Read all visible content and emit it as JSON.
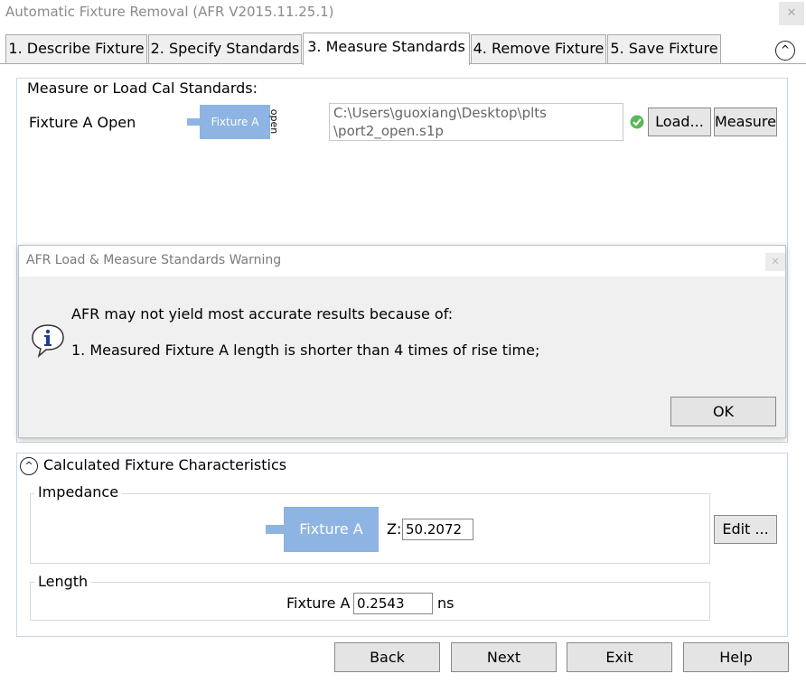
{
  "window": {
    "title": "Automatic Fixture Removal (AFR V2015.11.25.1)",
    "close_glyph": "✕"
  },
  "tabs": [
    {
      "label": "1. Describe Fixture"
    },
    {
      "label": "2. Specify Standards"
    },
    {
      "label": "3. Measure Standards"
    },
    {
      "label": "4. Remove Fixture"
    },
    {
      "label": "5. Save Fixture"
    }
  ],
  "active_tab": 2,
  "collapse_glyph": "^",
  "measure_section": {
    "heading": "Measure or Load Cal Standards:",
    "fixture_label": "Fixture A Open",
    "diagram_box_label": "Fixture A",
    "diagram_open_label": "open",
    "file_path_line1": "C:\\Users\\guoxiang\\Desktop\\plts",
    "file_path_line2": "\\port2_open.s1p",
    "status_icon": "check-icon",
    "load_label": "Load...",
    "measure_label": "Measure"
  },
  "dialog": {
    "title": "AFR Load & Measure Standards Warning",
    "message_line1": "AFR may not yield most accurate results because of:",
    "message_line2": "1. Measured Fixture A length is shorter than 4 times of rise time;",
    "ok_label": "OK",
    "icon": "info-icon"
  },
  "calculated": {
    "heading": "Calculated Fixture Characteristics",
    "impedance_legend": "Impedance",
    "impedance_box_label": "Fixture A",
    "z_label": "Z:",
    "z_value": "50.2072",
    "edit_label": "Edit ...",
    "length_legend": "Length",
    "length_label": "Fixture A",
    "length_value": "0.2543",
    "length_unit": "ns"
  },
  "bottom_buttons": {
    "back": "Back",
    "next": "Next",
    "exit": "Exit",
    "help": "Help"
  },
  "colors": {
    "fixture_blue": "#8db4e2",
    "panel_border": "#c8d8e8",
    "dialog_bg": "#f0f0f0"
  }
}
